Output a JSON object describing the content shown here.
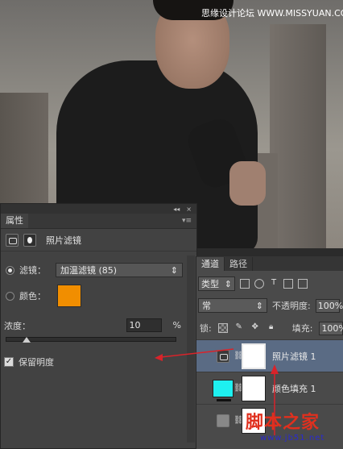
{
  "watermark": "思缘设计论坛 WWW.MISSYUAN.COM",
  "properties": {
    "tab_label": "属性",
    "panel_title": "照片滤镜",
    "filter_label": "滤镜：",
    "filter_value": "加温滤镜 (85)",
    "color_label": "颜色：",
    "color_value": "#f18e00",
    "density_label": "浓度：",
    "density_value": "10",
    "density_unit": "%",
    "density_level": 10,
    "preserve_label": "保留明度",
    "preserve_checked": true,
    "topbar_arrows": "◂◂",
    "topbar_close": "×",
    "menu_glyph": "▾≡"
  },
  "layers": {
    "tabs": [
      "通道",
      "路径"
    ],
    "kind_label": "类型",
    "blend_mode": "常",
    "opacity_label": "不透明度:",
    "opacity_value": "100%",
    "fill_label": "填充:",
    "fill_value": "100%",
    "lock_label": "锁:",
    "items": [
      {
        "name": "照片滤镜 1",
        "selected": true
      },
      {
        "name": "颜色填充 1",
        "selected": false
      },
      {
        "name": "",
        "selected": false
      }
    ]
  },
  "logo": {
    "main": "脚本之家",
    "sub": "www.jb51.net"
  },
  "colors": {
    "arrow": "#d9232a",
    "selected_layer": "#5a6b84",
    "fill_layer": "#1ef1f1"
  }
}
